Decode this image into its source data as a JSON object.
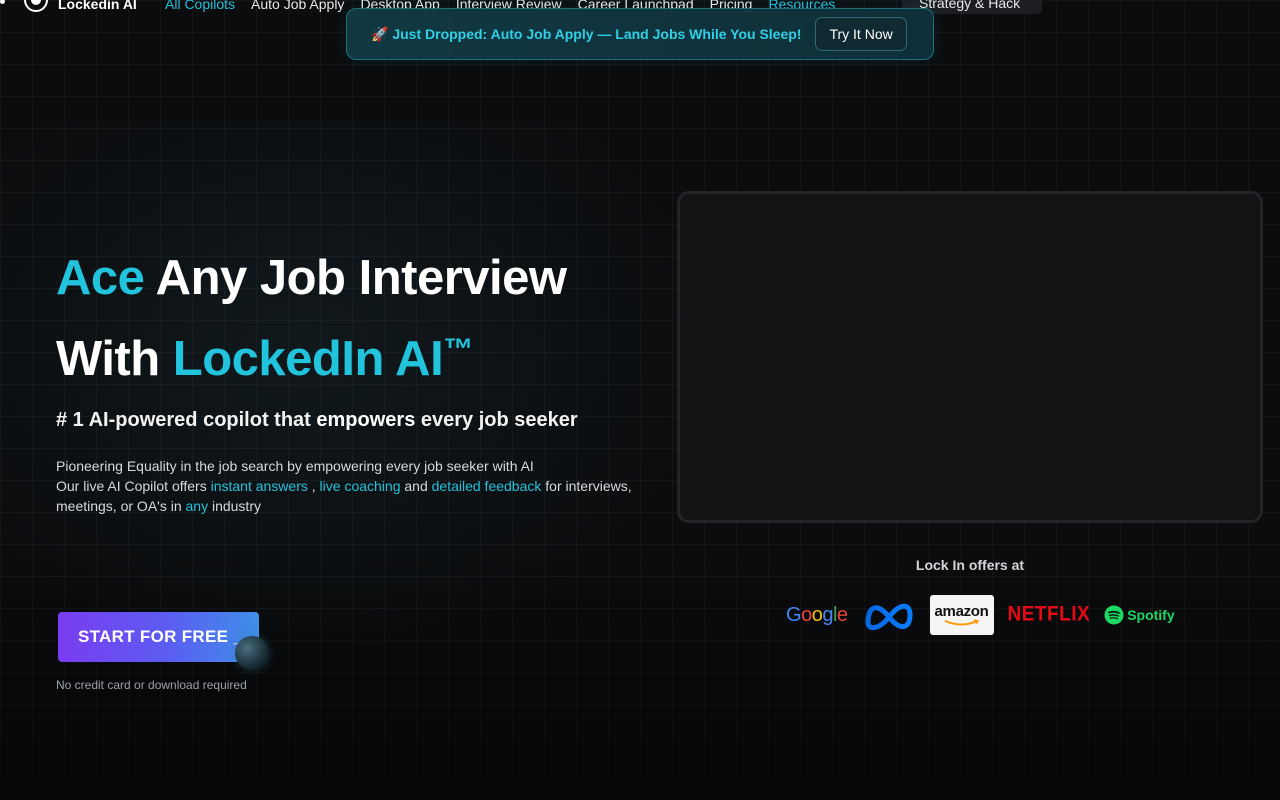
{
  "nav": {
    "brand": "Lockedin AI",
    "links": [
      "All Copilots",
      "Auto Job Apply",
      "Desktop App",
      "Interview Review",
      "Career Launchpad",
      "Pricing",
      "Resources"
    ],
    "pill": "Strategy & Hack"
  },
  "banner": {
    "emoji": "🚀",
    "text": "Just Dropped: Auto Job Apply — Land Jobs While You Sleep!",
    "button": "Try It Now"
  },
  "hero": {
    "line1_accent": "Ace",
    "line1_rest": " Any Job Interview",
    "line2_lead": "With ",
    "line2_accent": "LockedIn AI",
    "trademark": "™",
    "subtitle_pre": "# 1 AI-powered copilot that ",
    "subtitle_bold": "empowers",
    "subtitle_post": " every job seeker",
    "desc_line1": "Pioneering Equality in the job search by empowering every job seeker with AI",
    "desc_pre": "Our live AI Copilot offers ",
    "desc_hl1": "instant answers",
    "desc_sep1": " , ",
    "desc_hl2": "live coaching",
    "desc_and": " and ",
    "desc_hl3": "detailed feedback",
    "desc_for": " for interviews, meetings, or OA's in ",
    "desc_hl4": "any",
    "desc_end": " industry"
  },
  "cta": {
    "label": "START FOR FREE _",
    "note": "No credit card or download required"
  },
  "offers": {
    "title": "Lock In offers at",
    "companies": [
      "Google",
      "Meta",
      "amazon",
      "NETFLIX",
      "Spotify"
    ]
  },
  "colors": {
    "accent": "#22c3dd",
    "background": "#0b0c0e",
    "cta_start": "#7a3cf0",
    "cta_end": "#3e8fe8"
  }
}
